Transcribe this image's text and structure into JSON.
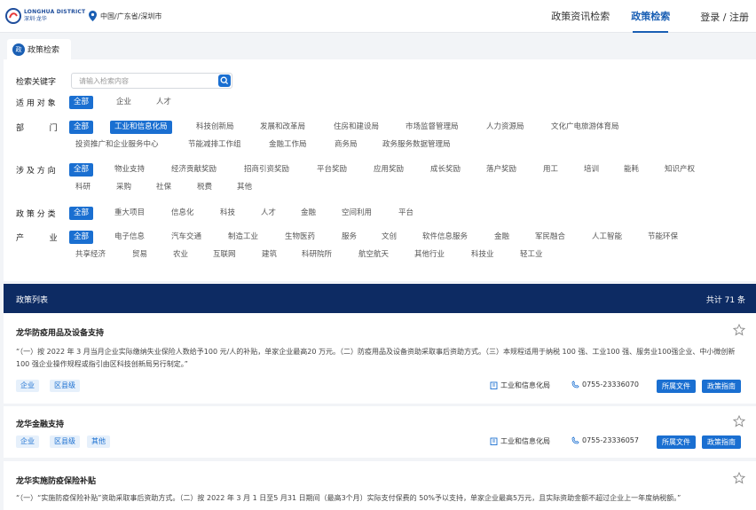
{
  "header": {
    "logo_en": "LONGHUA DISTRICT",
    "logo_cn": "深圳·龙华",
    "location": "中国/广东省/深圳市",
    "nav": [
      "政策资讯检索",
      "政策检索"
    ],
    "login": "登录 / 注册"
  },
  "tab": {
    "badge": "政",
    "label": "政策检索"
  },
  "filters": {
    "keyword_label": "检索关键字",
    "keyword_placeholder": "请输入检索内容",
    "target_label": "适 用 对 象",
    "target_options": [
      "全部",
      "企业",
      "人才"
    ],
    "dept_label": "部          门",
    "dept_options": [
      "全部",
      "工业和信息化局",
      "科技创新局",
      "发展和改革局",
      "住房和建设局",
      "市场监督管理局",
      "人力资源局",
      "文化广电旅游体育局",
      "投资推广和企业服务中心",
      "节能减排工作组",
      "金融工作局",
      "商务局",
      "政务服务数据管理局"
    ],
    "direction_label": "涉 及 方 向",
    "direction_options": [
      "全部",
      "物业支持",
      "经济贡献奖励",
      "招商引资奖励",
      "平台奖励",
      "应用奖励",
      "成长奖励",
      "落户奖励",
      "用工",
      "培训",
      "能耗",
      "知识产权",
      "科研",
      "采购",
      "社保",
      "税费",
      "其他"
    ],
    "category_label": "政 策 分 类",
    "category_options": [
      "全部",
      "重大项目",
      "信息化",
      "科技",
      "人才",
      "金融",
      "空间利用",
      "平台"
    ],
    "industry_label": "产          业",
    "industry_options": [
      "全部",
      "电子信息",
      "汽车交通",
      "制造工业",
      "生物医药",
      "服务",
      "文创",
      "软件信息服务",
      "金融",
      "军民融合",
      "人工智能",
      "节能环保",
      "共享经济",
      "贸易",
      "农业",
      "互联网",
      "建筑",
      "科研院所",
      "航空航天",
      "其他行业",
      "科技业",
      "轻工业"
    ]
  },
  "list": {
    "title": "政策列表",
    "count": "共计 71 条",
    "items": [
      {
        "title": "龙华防疫用品及设备支持",
        "desc": "“（一）按 2022 年 3 月当月企业实际缴纳失业保险人数给予100 元/人的补贴，单家企业最高20 万元。（二）防疫用品及设备资助采取事后资助方式。（三）本规程适用于纳税 100 强、工业100 强、服务业100强企业、中小微创新 100 强企业操作规程或指引由区科技创新局另行制定。”",
        "tags": [
          "企业",
          "区县级"
        ],
        "dept": "工业和信息化局",
        "phone": "0755-23336070",
        "btn1": "所属文件",
        "btn2": "政策指南"
      },
      {
        "title": "龙华金融支持",
        "tags": [
          "企业",
          "区县级",
          "其他"
        ],
        "dept": "工业和信息化局",
        "phone": "0755-23336057",
        "btn1": "所属文件",
        "btn2": "政策指南"
      },
      {
        "title": "龙华实施防疫保险补贴",
        "desc": "“（一）“实施防疫保险补贴”资助采取事后资助方式。（二）按 2022 年 3 月 1 日至5 月31 日期间（最高3个月）实际支付保费的 50%予以支持，单家企业最高5万元，且实际资助金额不超过企业上一年度纳税额。”"
      }
    ]
  },
  "colors": {
    "brand": "#1a6fd1",
    "list_header": "#0d2b63",
    "nav_active": "#1a5fb4"
  }
}
